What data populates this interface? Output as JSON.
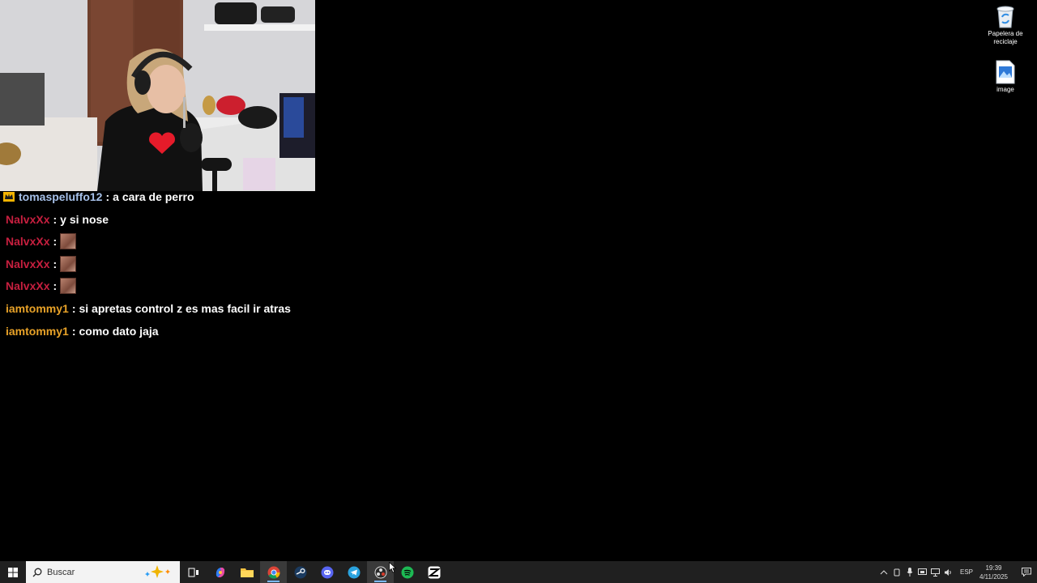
{
  "chat": {
    "messages": [
      {
        "user": "tomaspeluffo12",
        "color": "#a6c0e8",
        "text": "a cara de perro",
        "badge": "crown-badge",
        "emote": false
      },
      {
        "user": "NalvxXx",
        "color": "#c71f3f",
        "text": "y si nose",
        "emote": false
      },
      {
        "user": "NalvxXx",
        "color": "#c71f3f",
        "text": "",
        "emote": true
      },
      {
        "user": "NalvxXx",
        "color": "#c71f3f",
        "text": "",
        "emote": true
      },
      {
        "user": "NalvxXx",
        "color": "#c71f3f",
        "text": "",
        "emote": true
      },
      {
        "user": "iamtommy1",
        "color": "#e8a228",
        "text": "si apretas control z es mas facil ir atras",
        "emote": false
      },
      {
        "user": "iamtommy1",
        "color": "#e8a228",
        "text": "como dato jaja",
        "emote": false
      }
    ],
    "separator": ":"
  },
  "desktop": {
    "icons": [
      {
        "label": "Papelera de reciclaje",
        "icon": "recycle-bin-icon"
      },
      {
        "label": "image",
        "icon": "image-file-icon"
      }
    ]
  },
  "taskbar": {
    "search_placeholder": "Buscar",
    "apps": [
      "task-view-icon",
      "copilot-icon",
      "file-explorer-icon",
      "chrome-icon",
      "steam-icon",
      "discord-icon",
      "telegram-icon",
      "obs-icon",
      "spotify-icon",
      "capcut-icon"
    ],
    "tray": {
      "language": "ESP",
      "time": "19:39",
      "date": "4/11/2025"
    }
  },
  "colors": {
    "taskbar_bg": "#202020",
    "desktop_bg": "#000000",
    "active_indicator": "#7ab8ff"
  }
}
